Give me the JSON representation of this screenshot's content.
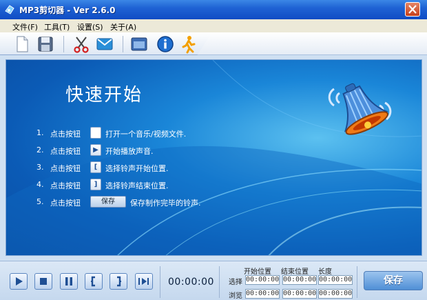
{
  "window": {
    "title": "MP3剪切器 - Ver 2.6.0"
  },
  "menu": {
    "items": [
      {
        "label": "文件(F)"
      },
      {
        "label": "工具(T)"
      },
      {
        "label": "设置(S)"
      },
      {
        "label": "关于(A)"
      }
    ]
  },
  "toolbar": {
    "buttons": [
      "new-file-icon",
      "save-icon",
      "scissors-icon",
      "email-icon",
      "window-icon",
      "info-icon",
      "running-man-icon"
    ]
  },
  "guide": {
    "heading": "快速开始",
    "steps": [
      {
        "num": "1.",
        "pre": "点击按钮",
        "post": "打开一个音乐/视频文件."
      },
      {
        "num": "2.",
        "pre": "点击按钮",
        "post": "开始播放声音."
      },
      {
        "num": "3.",
        "pre": "点击按钮",
        "post": "选择铃声开始位置."
      },
      {
        "num": "4.",
        "pre": "点击按钮",
        "post": "选择铃声结束位置."
      },
      {
        "num": "5.",
        "pre": "点击按钮",
        "post": "保存制作完毕的铃声."
      }
    ],
    "save_icon_label": "保存"
  },
  "player": {
    "time": "00:00:00"
  },
  "positions": {
    "headers": {
      "start": "开始位置",
      "end": "结束位置",
      "length": "长度"
    },
    "rows": [
      {
        "label": "选择",
        "start": "00:00:00",
        "end": "00:00:00",
        "length": "00:00:00"
      },
      {
        "label": "浏览",
        "start": "00:00:00",
        "end": "00:00:00",
        "length": "00:00:00"
      }
    ]
  },
  "save_button": "保存",
  "colors": {
    "title_bar": "#1f63d4",
    "panel_blue": "#0b5bb6",
    "bell_orange": "#f07a16"
  }
}
